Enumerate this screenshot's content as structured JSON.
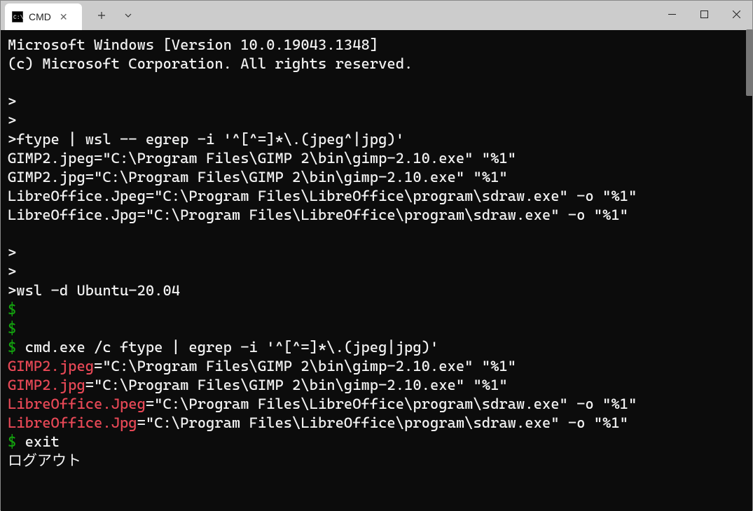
{
  "tab": {
    "title": "CMD"
  },
  "terminal": {
    "header": [
      "Microsoft Windows [Version 10.0.19043.1348]",
      "(c) Microsoft Corporation. All rights reserved."
    ],
    "cmd_prompt": ">",
    "cmd_lines": {
      "p1": ">",
      "p2": ">",
      "ftype_cmd": ">ftype | wsl -- egrep -i '^[^=]*\\.(jpeg^|jpg)'",
      "out1": "GIMP2.jpeg=\"C:\\Program Files\\GIMP 2\\bin\\gimp-2.10.exe\" \"%1\"",
      "out2": "GIMP2.jpg=\"C:\\Program Files\\GIMP 2\\bin\\gimp-2.10.exe\" \"%1\"",
      "out3": "LibreOffice.Jpeg=\"C:\\Program Files\\LibreOffice\\program\\sdraw.exe\" -o \"%1\"",
      "out4": "LibreOffice.Jpg=\"C:\\Program Files\\LibreOffice\\program\\sdraw.exe\" -o \"%1\"",
      "p3": ">",
      "p4": ">",
      "wsl_cmd": ">wsl -d Ubuntu-20.04"
    },
    "wsl_prompt": "$",
    "wsl_lines": {
      "p1": "$",
      "p2": "$",
      "cmd_prompt": "$ ",
      "cmd_text": "cmd.exe /c ftype | egrep -i '^[^=]*\\.(jpeg|jpg)'",
      "r1_key": "GIMP2.jpeg",
      "r1_val": "=\"C:\\Program Files\\GIMP 2\\bin\\gimp-2.10.exe\" \"%1\"",
      "r2_key": "GIMP2.jpg",
      "r2_val": "=\"C:\\Program Files\\GIMP 2\\bin\\gimp-2.10.exe\" \"%1\"",
      "r3_key": "LibreOffice.Jpeg",
      "r3_val": "=\"C:\\Program Files\\LibreOffice\\program\\sdraw.exe\" -o \"%1\"",
      "r4_key": "LibreOffice.Jpg",
      "r4_val": "=\"C:\\Program Files\\LibreOffice\\program\\sdraw.exe\" -o \"%1\"",
      "exit_prompt": "$ ",
      "exit_cmd": "exit",
      "logout": "ログアウト"
    }
  },
  "colors": {
    "green": "#13a10e",
    "red": "#e74856",
    "bg": "#0c0c0c"
  }
}
